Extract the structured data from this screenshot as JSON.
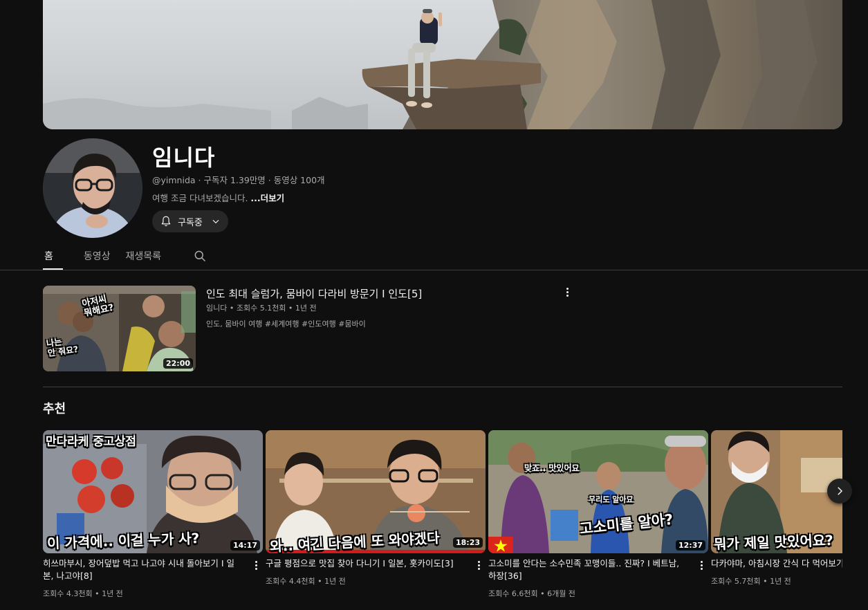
{
  "channel": {
    "name": "임니다",
    "handle": "@yimnida",
    "stats": " · 구독자 1.39만명 · 동영상 100개",
    "description": "여행 조금 다녀보겠습니다. ",
    "more_label": "...더보기",
    "subscribe_label": "구독중"
  },
  "tabs": [
    {
      "label": "홈",
      "active": true
    },
    {
      "label": "동영상",
      "active": false
    },
    {
      "label": "재생목록",
      "active": false
    }
  ],
  "featured": {
    "title": "인도 최대 슬럼가, 뭄바이 다라비 방문기 I 인도[5]",
    "meta": "임니다 • 조회수 5.1천회 • 1년 전",
    "tags": "인도, 뭄바이 여행 #세계여행 #인도여행 #뭄바이",
    "duration": "22:00",
    "thumb_text": [
      "아저씨",
      "뭐해요?",
      "나는",
      "안 줘요?"
    ]
  },
  "recommended": {
    "section_title": "추천",
    "videos": [
      {
        "title": "히쓰마부시, 장어덮밥 먹고 나고야 시내 돌아보기 I 일본, 나고야[8]",
        "meta": "조회수 4.3천회 • 1년 전",
        "duration": "14:17",
        "thumb_top": "만다라케 중고상점",
        "thumb_bottom": "이 가격에.. 이걸 누가 사?"
      },
      {
        "title": "구글 평점으로 맛집 찾아 다니기 I 일본, 홋카이도[3]",
        "meta": "조회수 4.4천회 • 1년 전",
        "duration": "18:23",
        "thumb_top": "",
        "thumb_bottom": "와.. 여긴 다음에 또 와야겠다"
      },
      {
        "title": "고소미를 안다는 소수민족 꼬맹이들.. 진짜? I 베트남, 하장[36]",
        "meta": "조회수 6.6천회 • 6개월 전",
        "duration": "12:37",
        "thumb_top": "맞죠.. 맛있어요",
        "thumb_mid": "우리도 알아요",
        "thumb_bottom": "고소미를 알아?"
      },
      {
        "title": "다카야마, 아침시장 간식 다 먹어보기",
        "meta": "조회수 5.7천회 • 1년 전",
        "duration": "",
        "thumb_top": "",
        "thumb_bottom": "뭐가 제일 맛있어요?"
      }
    ]
  },
  "colors": {
    "background": "#0f0f0f",
    "text_primary": "#f1f1f1",
    "text_secondary": "#aaaaaa",
    "progress_red": "#ff0000",
    "flag_red": "#da251d",
    "flag_yellow": "#ffff00"
  },
  "icons": [
    "bell-icon",
    "chevron-down-icon",
    "search-icon",
    "more-vert-icon",
    "chevron-right-icon",
    "vietnam-flag-icon"
  ]
}
